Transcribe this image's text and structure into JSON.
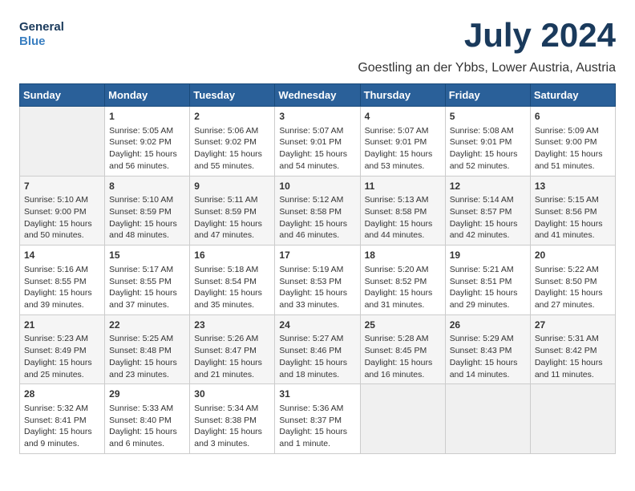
{
  "logo": {
    "line1": "General",
    "line2": "Blue"
  },
  "header": {
    "month_year": "July 2024",
    "location": "Goestling an der Ybbs, Lower Austria, Austria"
  },
  "weekdays": [
    "Sunday",
    "Monday",
    "Tuesday",
    "Wednesday",
    "Thursday",
    "Friday",
    "Saturday"
  ],
  "weeks": [
    [
      {
        "day": "",
        "content": ""
      },
      {
        "day": "1",
        "content": "Sunrise: 5:05 AM\nSunset: 9:02 PM\nDaylight: 15 hours\nand 56 minutes."
      },
      {
        "day": "2",
        "content": "Sunrise: 5:06 AM\nSunset: 9:02 PM\nDaylight: 15 hours\nand 55 minutes."
      },
      {
        "day": "3",
        "content": "Sunrise: 5:07 AM\nSunset: 9:01 PM\nDaylight: 15 hours\nand 54 minutes."
      },
      {
        "day": "4",
        "content": "Sunrise: 5:07 AM\nSunset: 9:01 PM\nDaylight: 15 hours\nand 53 minutes."
      },
      {
        "day": "5",
        "content": "Sunrise: 5:08 AM\nSunset: 9:01 PM\nDaylight: 15 hours\nand 52 minutes."
      },
      {
        "day": "6",
        "content": "Sunrise: 5:09 AM\nSunset: 9:00 PM\nDaylight: 15 hours\nand 51 minutes."
      }
    ],
    [
      {
        "day": "7",
        "content": "Sunrise: 5:10 AM\nSunset: 9:00 PM\nDaylight: 15 hours\nand 50 minutes."
      },
      {
        "day": "8",
        "content": "Sunrise: 5:10 AM\nSunset: 8:59 PM\nDaylight: 15 hours\nand 48 minutes."
      },
      {
        "day": "9",
        "content": "Sunrise: 5:11 AM\nSunset: 8:59 PM\nDaylight: 15 hours\nand 47 minutes."
      },
      {
        "day": "10",
        "content": "Sunrise: 5:12 AM\nSunset: 8:58 PM\nDaylight: 15 hours\nand 46 minutes."
      },
      {
        "day": "11",
        "content": "Sunrise: 5:13 AM\nSunset: 8:58 PM\nDaylight: 15 hours\nand 44 minutes."
      },
      {
        "day": "12",
        "content": "Sunrise: 5:14 AM\nSunset: 8:57 PM\nDaylight: 15 hours\nand 42 minutes."
      },
      {
        "day": "13",
        "content": "Sunrise: 5:15 AM\nSunset: 8:56 PM\nDaylight: 15 hours\nand 41 minutes."
      }
    ],
    [
      {
        "day": "14",
        "content": "Sunrise: 5:16 AM\nSunset: 8:55 PM\nDaylight: 15 hours\nand 39 minutes."
      },
      {
        "day": "15",
        "content": "Sunrise: 5:17 AM\nSunset: 8:55 PM\nDaylight: 15 hours\nand 37 minutes."
      },
      {
        "day": "16",
        "content": "Sunrise: 5:18 AM\nSunset: 8:54 PM\nDaylight: 15 hours\nand 35 minutes."
      },
      {
        "day": "17",
        "content": "Sunrise: 5:19 AM\nSunset: 8:53 PM\nDaylight: 15 hours\nand 33 minutes."
      },
      {
        "day": "18",
        "content": "Sunrise: 5:20 AM\nSunset: 8:52 PM\nDaylight: 15 hours\nand 31 minutes."
      },
      {
        "day": "19",
        "content": "Sunrise: 5:21 AM\nSunset: 8:51 PM\nDaylight: 15 hours\nand 29 minutes."
      },
      {
        "day": "20",
        "content": "Sunrise: 5:22 AM\nSunset: 8:50 PM\nDaylight: 15 hours\nand 27 minutes."
      }
    ],
    [
      {
        "day": "21",
        "content": "Sunrise: 5:23 AM\nSunset: 8:49 PM\nDaylight: 15 hours\nand 25 minutes."
      },
      {
        "day": "22",
        "content": "Sunrise: 5:25 AM\nSunset: 8:48 PM\nDaylight: 15 hours\nand 23 minutes."
      },
      {
        "day": "23",
        "content": "Sunrise: 5:26 AM\nSunset: 8:47 PM\nDaylight: 15 hours\nand 21 minutes."
      },
      {
        "day": "24",
        "content": "Sunrise: 5:27 AM\nSunset: 8:46 PM\nDaylight: 15 hours\nand 18 minutes."
      },
      {
        "day": "25",
        "content": "Sunrise: 5:28 AM\nSunset: 8:45 PM\nDaylight: 15 hours\nand 16 minutes."
      },
      {
        "day": "26",
        "content": "Sunrise: 5:29 AM\nSunset: 8:43 PM\nDaylight: 15 hours\nand 14 minutes."
      },
      {
        "day": "27",
        "content": "Sunrise: 5:31 AM\nSunset: 8:42 PM\nDaylight: 15 hours\nand 11 minutes."
      }
    ],
    [
      {
        "day": "28",
        "content": "Sunrise: 5:32 AM\nSunset: 8:41 PM\nDaylight: 15 hours\nand 9 minutes."
      },
      {
        "day": "29",
        "content": "Sunrise: 5:33 AM\nSunset: 8:40 PM\nDaylight: 15 hours\nand 6 minutes."
      },
      {
        "day": "30",
        "content": "Sunrise: 5:34 AM\nSunset: 8:38 PM\nDaylight: 15 hours\nand 3 minutes."
      },
      {
        "day": "31",
        "content": "Sunrise: 5:36 AM\nSunset: 8:37 PM\nDaylight: 15 hours\nand 1 minute."
      },
      {
        "day": "",
        "content": ""
      },
      {
        "day": "",
        "content": ""
      },
      {
        "day": "",
        "content": ""
      }
    ]
  ]
}
